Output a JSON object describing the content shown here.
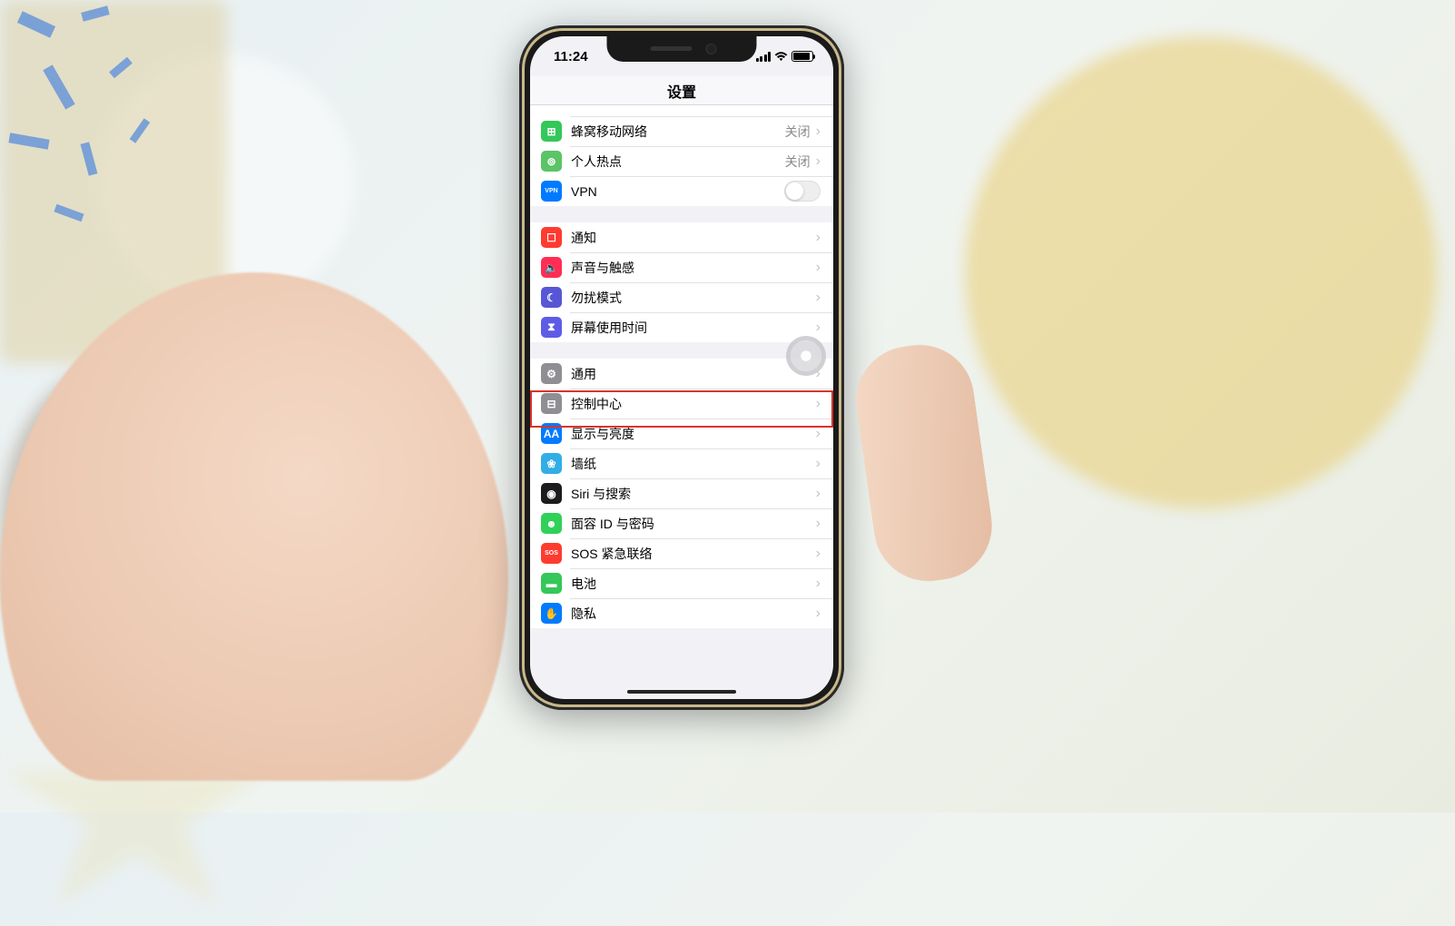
{
  "status": {
    "time": "11:24"
  },
  "nav": {
    "title": "设置"
  },
  "groups": [
    {
      "rows": [
        {
          "icon": "cellular-icon",
          "iconClass": "ic-green",
          "glyph": "⊞",
          "label": "蜂窝移动网络",
          "value": "关闭",
          "accessory": "chevron"
        },
        {
          "icon": "hotspot-icon",
          "iconClass": "ic-lightgreen",
          "glyph": "⊚",
          "label": "个人热点",
          "value": "关闭",
          "accessory": "chevron"
        },
        {
          "icon": "vpn-icon",
          "iconClass": "ic-dblue",
          "glyph": "VPN",
          "label": "VPN",
          "value": "",
          "accessory": "toggle-off"
        }
      ],
      "partialTop": true
    },
    {
      "rows": [
        {
          "icon": "notifications-icon",
          "iconClass": "ic-red",
          "glyph": "☐",
          "label": "通知",
          "value": "",
          "accessory": "chevron"
        },
        {
          "icon": "sounds-icon",
          "iconClass": "ic-pink",
          "glyph": "🔈",
          "label": "声音与触感",
          "value": "",
          "accessory": "chevron"
        },
        {
          "icon": "dnd-icon",
          "iconClass": "ic-purple",
          "glyph": "☾",
          "label": "勿扰模式",
          "value": "",
          "accessory": "chevron"
        },
        {
          "icon": "screentime-icon",
          "iconClass": "ic-indigo",
          "glyph": "⧗",
          "label": "屏幕使用时间",
          "value": "",
          "accessory": "chevron"
        }
      ]
    },
    {
      "rows": [
        {
          "icon": "general-icon",
          "iconClass": "ic-gray",
          "glyph": "⚙",
          "label": "通用",
          "value": "",
          "accessory": "chevron",
          "highlighted": true
        },
        {
          "icon": "control-center-icon",
          "iconClass": "ic-gray",
          "glyph": "⊟",
          "label": "控制中心",
          "value": "",
          "accessory": "chevron"
        },
        {
          "icon": "display-icon",
          "iconClass": "ic-dblue",
          "glyph": "AA",
          "label": "显示与亮度",
          "value": "",
          "accessory": "chevron"
        },
        {
          "icon": "wallpaper-icon",
          "iconClass": "ic-cyan",
          "glyph": "❀",
          "label": "墙纸",
          "value": "",
          "accessory": "chevron"
        },
        {
          "icon": "siri-icon",
          "iconClass": "ic-black",
          "glyph": "◉",
          "label": "Siri 与搜索",
          "value": "",
          "accessory": "chevron"
        },
        {
          "icon": "faceid-icon",
          "iconClass": "ic-green2",
          "glyph": "☻",
          "label": "面容 ID 与密码",
          "value": "",
          "accessory": "chevron"
        },
        {
          "icon": "sos-icon",
          "iconClass": "ic-red",
          "glyph": "SOS",
          "label": "SOS 紧急联络",
          "value": "",
          "accessory": "chevron"
        },
        {
          "icon": "battery-icon",
          "iconClass": "ic-green",
          "glyph": "▬",
          "label": "电池",
          "value": "",
          "accessory": "chevron"
        },
        {
          "icon": "privacy-icon",
          "iconClass": "ic-dblue",
          "glyph": "✋",
          "label": "隐私",
          "value": "",
          "accessory": "chevron"
        }
      ]
    }
  ],
  "highlight": {
    "rowLabel": "通用"
  }
}
